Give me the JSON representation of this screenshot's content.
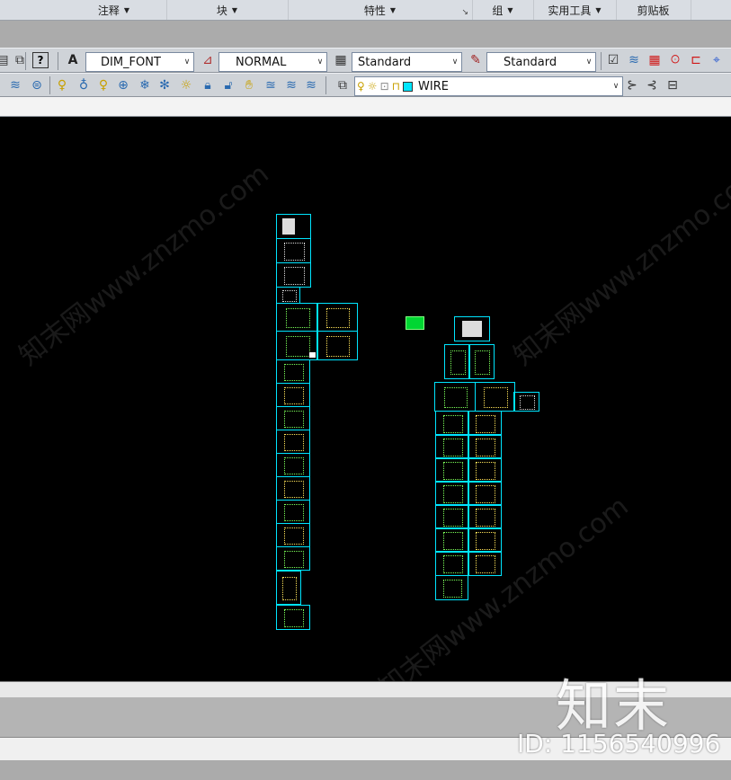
{
  "ribbon": {
    "panels": [
      {
        "label": "注释",
        "icon": "triangle-down-icon"
      },
      {
        "label": "块",
        "icon": "triangle-down-icon"
      },
      {
        "label": "特性",
        "icon": "triangle-down-icon"
      },
      {
        "label": "组",
        "icon": "triangle-down-icon"
      },
      {
        "label": "实用工具",
        "icon": "triangle-down-icon"
      },
      {
        "label": "剪贴板"
      }
    ]
  },
  "toolbar1": {
    "text_style": "DIM_FONT",
    "dim_style": "NORMAL",
    "table_style": "Standard",
    "multileader_style": "Standard"
  },
  "toolbar2": {
    "layer": "WIRE"
  },
  "watermark": {
    "logo": "知末",
    "id": "ID: 1156540996",
    "diagonal": "知末网www.znzmo.com"
  },
  "colors": {
    "canvas": "#000000",
    "sheet_border": "#00e5ff",
    "plan_green": "#7cff5a",
    "plan_yellow": "#ffe45a",
    "marker": "#00d632"
  }
}
